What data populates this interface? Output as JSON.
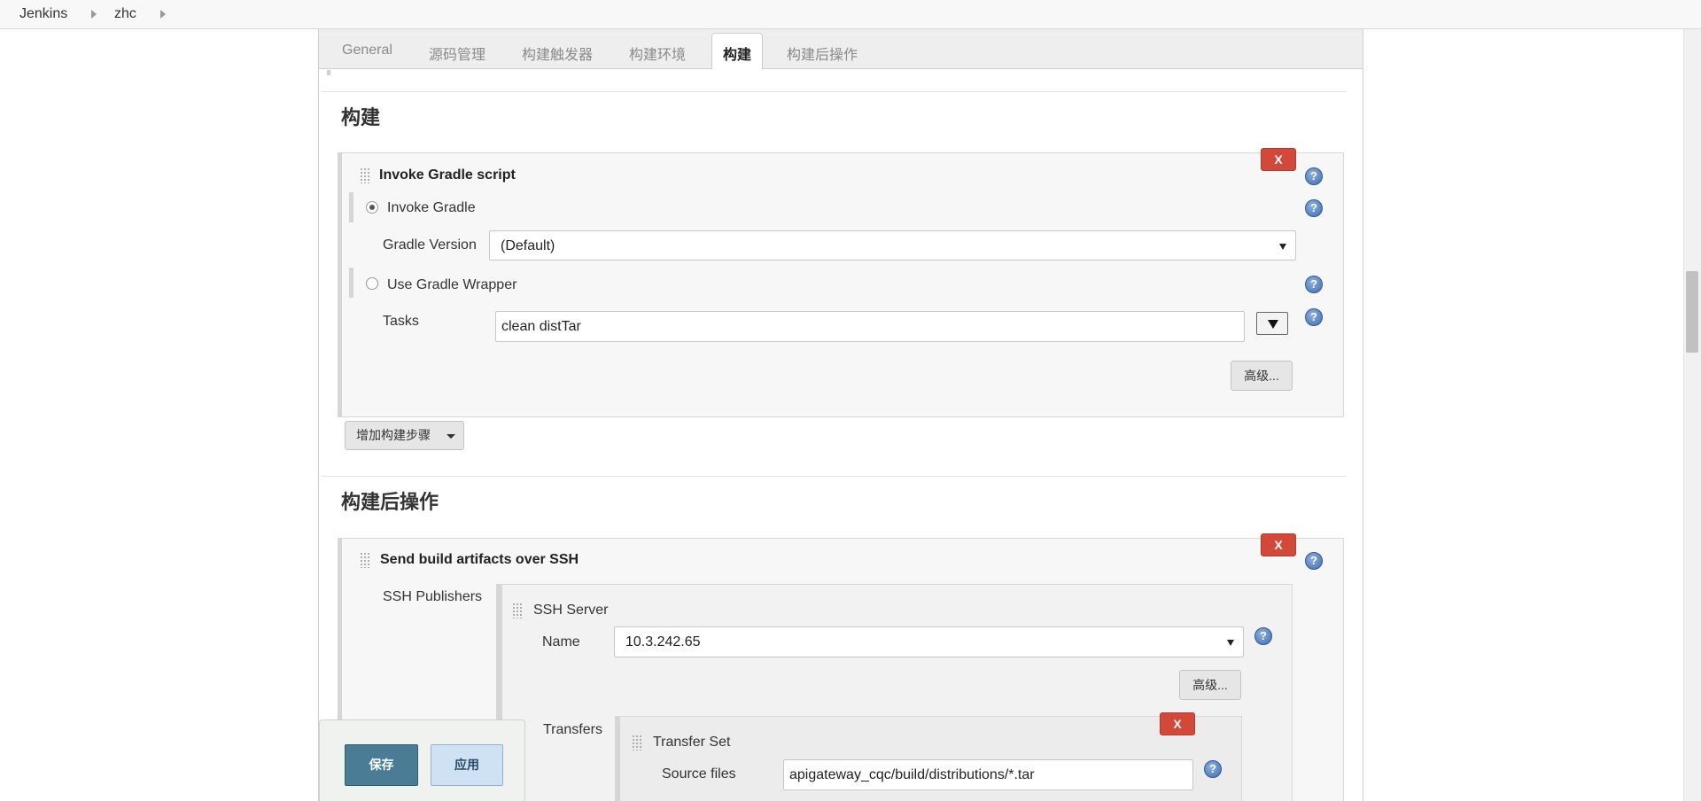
{
  "breadcrumb": [
    "Jenkins",
    "zhc"
  ],
  "tabs": [
    "General",
    "源码管理",
    "构建触发器",
    "构建环境",
    "构建",
    "构建后操作"
  ],
  "active_tab": "构建",
  "build_section": {
    "title": "构建",
    "step": {
      "title": "Invoke Gradle script",
      "delete_label": "X",
      "invoke_gradle_label": "Invoke Gradle",
      "gradle_version_label": "Gradle Version",
      "gradle_version_value": "(Default)",
      "use_wrapper_label": "Use Gradle Wrapper",
      "tasks_label": "Tasks",
      "tasks_value": "clean distTar",
      "advanced_label": "高级..."
    },
    "add_step_label": "增加构建步骤"
  },
  "post_build_section": {
    "title": "构建后操作",
    "step": {
      "title": "Send build artifacts over SSH",
      "delete_label": "X",
      "ssh_publishers_label": "SSH Publishers",
      "ssh_server_label": "SSH Server",
      "name_label": "Name",
      "name_value": "10.3.242.65",
      "advanced_label": "高级...",
      "transfers_label": "Transfers",
      "transfer_set_label": "Transfer Set",
      "transfer_delete_label": "X",
      "source_files_label": "Source files",
      "source_files_value": "apigateway_cqc/build/distributions/*.tar"
    }
  },
  "footer": {
    "save_label": "保存",
    "apply_label": "应用"
  },
  "help_glyph": "?",
  "colors": {
    "delete_button": "#d24939",
    "help_icon": "#3f6db3",
    "save_button": "#4a7d95",
    "apply_button": "#cfe2f3"
  }
}
